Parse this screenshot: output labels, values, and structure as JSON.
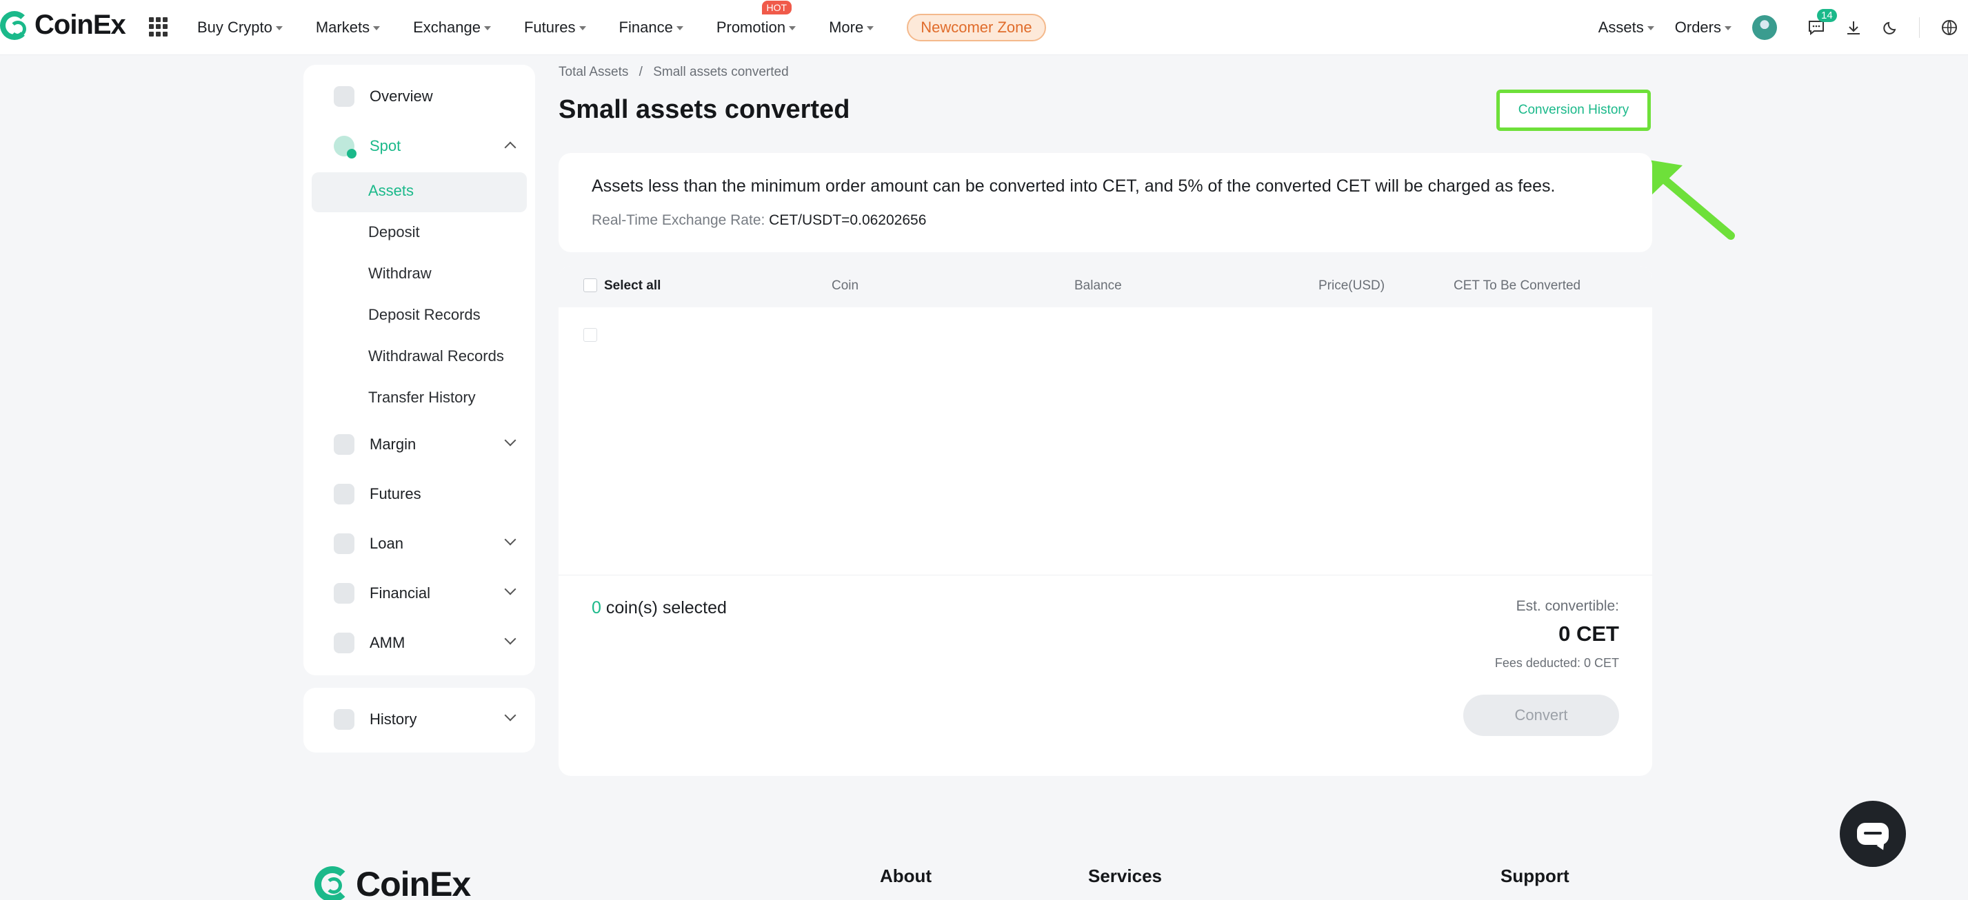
{
  "brand": {
    "name": "CoinEx",
    "accent": "#1bb98a",
    "highlight": "#6ee03a"
  },
  "nav": {
    "items": [
      "Buy Crypto",
      "Markets",
      "Exchange",
      "Futures",
      "Finance",
      "Promotion",
      "More"
    ],
    "hot_badge": "HOT",
    "newcomer": "Newcomer Zone",
    "right": {
      "assets": "Assets",
      "orders": "Orders",
      "messages_count": "14"
    }
  },
  "sidebar": {
    "overview": "Overview",
    "spot": "Spot",
    "spot_sub": [
      "Assets",
      "Deposit",
      "Withdraw",
      "Deposit Records",
      "Withdrawal Records",
      "Transfer History"
    ],
    "margin": "Margin",
    "futures": "Futures",
    "loan": "Loan",
    "financial": "Financial",
    "amm": "AMM",
    "history": "History"
  },
  "breadcrumb": {
    "root": "Total Assets",
    "sep": "/",
    "current": "Small assets converted"
  },
  "page": {
    "title": "Small assets converted",
    "conversion_history": "Conversion History"
  },
  "info": {
    "text": "Assets less than the minimum order amount can be converted into CET, and 5% of the converted CET will be charged as fees.",
    "rate_label": "Real-Time Exchange Rate",
    "rate_value": "CET/USDT=0.06202656"
  },
  "table": {
    "select_all": "Select all",
    "columns": [
      "Coin",
      "Balance",
      "Price(USD)",
      "CET To Be Converted"
    ]
  },
  "summary": {
    "count": "0",
    "count_suffix": "coin(s) selected",
    "est_label": "Est. convertible:",
    "est_value": "0 CET",
    "fees": "Fees deducted: 0 CET",
    "convert": "Convert"
  },
  "footer": {
    "brand": "CoinEx",
    "columns": [
      "About",
      "Services",
      "Support"
    ]
  }
}
